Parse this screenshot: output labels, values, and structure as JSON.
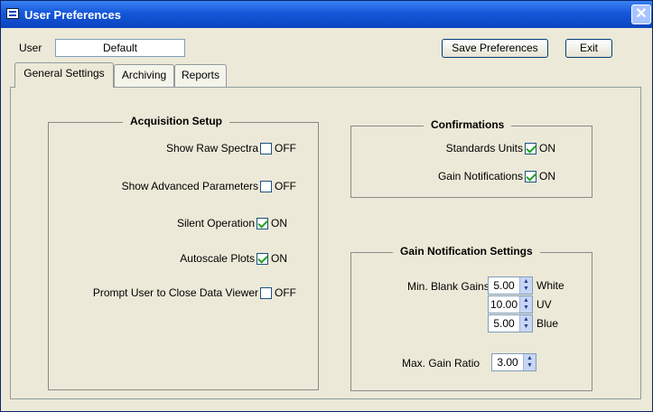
{
  "window": {
    "title": "User Preferences",
    "close_glyph": "✕"
  },
  "user": {
    "label": "User",
    "value": "Default"
  },
  "buttons": {
    "save": "Save Preferences",
    "exit": "Exit"
  },
  "tabs": [
    {
      "label": "General Settings",
      "active": true
    },
    {
      "label": "Archiving",
      "active": false
    },
    {
      "label": "Reports",
      "active": false
    }
  ],
  "acquisition": {
    "title": "Acquisition Setup",
    "items": [
      {
        "label": "Show Raw Spectra",
        "state": "OFF",
        "checked": false
      },
      {
        "label": "Show Advanced Parameters",
        "state": "OFF",
        "checked": false
      },
      {
        "label": "Silent Operation",
        "state": "ON",
        "checked": true
      },
      {
        "label": "Autoscale Plots",
        "state": "ON",
        "checked": true
      },
      {
        "label": "Prompt User to Close Data Viewer",
        "state": "OFF",
        "checked": false
      }
    ]
  },
  "confirmations": {
    "title": "Confirmations",
    "items": [
      {
        "label": "Standards Units",
        "state": "ON",
        "checked": true
      },
      {
        "label": "Gain Notifications",
        "state": "ON",
        "checked": true
      }
    ]
  },
  "gain": {
    "title": "Gain Notification Settings",
    "min_label": "Min. Blank Gains",
    "min": [
      {
        "value": "5.00",
        "unit": "White"
      },
      {
        "value": "10.00",
        "unit": "UV"
      },
      {
        "value": "5.00",
        "unit": "Blue"
      }
    ],
    "max_label": "Max. Gain Ratio",
    "max_value": "3.00"
  },
  "icons": {
    "spin_up": "▲",
    "spin_down": "▼"
  }
}
